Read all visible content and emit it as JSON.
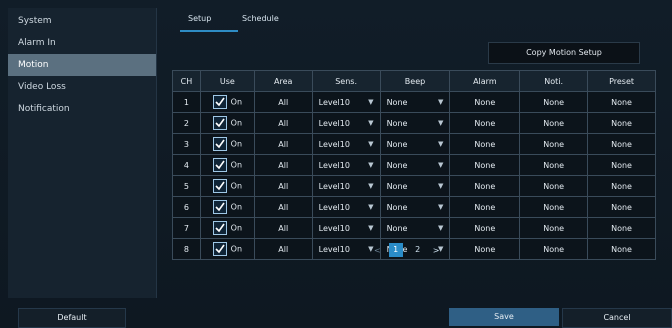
{
  "sidebar": {
    "items": [
      {
        "label": "System"
      },
      {
        "label": "Alarm In"
      },
      {
        "label": "Motion"
      },
      {
        "label": "Video Loss"
      },
      {
        "label": "Notification"
      }
    ]
  },
  "tabs": [
    {
      "label": "Setup"
    },
    {
      "label": "Schedule"
    }
  ],
  "copy_button": "Copy Motion Setup",
  "table": {
    "headers": [
      "CH",
      "Use",
      "Area",
      "Sens.",
      "Beep",
      "Alarm",
      "Noti.",
      "Preset"
    ],
    "rows": [
      {
        "ch": "1",
        "use": "On",
        "area": "All",
        "sens": "Level10",
        "beep": "None",
        "alarm": "None",
        "noti": "None",
        "preset": "None"
      },
      {
        "ch": "2",
        "use": "On",
        "area": "All",
        "sens": "Level10",
        "beep": "None",
        "alarm": "None",
        "noti": "None",
        "preset": "None"
      },
      {
        "ch": "3",
        "use": "On",
        "area": "All",
        "sens": "Level10",
        "beep": "None",
        "alarm": "None",
        "noti": "None",
        "preset": "None"
      },
      {
        "ch": "4",
        "use": "On",
        "area": "All",
        "sens": "Level10",
        "beep": "None",
        "alarm": "None",
        "noti": "None",
        "preset": "None"
      },
      {
        "ch": "5",
        "use": "On",
        "area": "All",
        "sens": "Level10",
        "beep": "None",
        "alarm": "None",
        "noti": "None",
        "preset": "None"
      },
      {
        "ch": "6",
        "use": "On",
        "area": "All",
        "sens": "Level10",
        "beep": "None",
        "alarm": "None",
        "noti": "None",
        "preset": "None"
      },
      {
        "ch": "7",
        "use": "On",
        "area": "All",
        "sens": "Level10",
        "beep": "None",
        "alarm": "None",
        "noti": "None",
        "preset": "None"
      },
      {
        "ch": "8",
        "use": "On",
        "area": "All",
        "sens": "Level10",
        "beep": "None",
        "alarm": "None",
        "noti": "None",
        "preset": "None"
      }
    ]
  },
  "pagination": {
    "prev": "<",
    "pages": [
      "1",
      "2"
    ],
    "next": ">",
    "current": "1"
  },
  "footer": {
    "default": "Default",
    "save": "Save",
    "cancel": "Cancel"
  },
  "colors": {
    "accent": "#2a8cc8",
    "active_sidebar": "#5b7080",
    "save_button": "#2f5f85"
  }
}
